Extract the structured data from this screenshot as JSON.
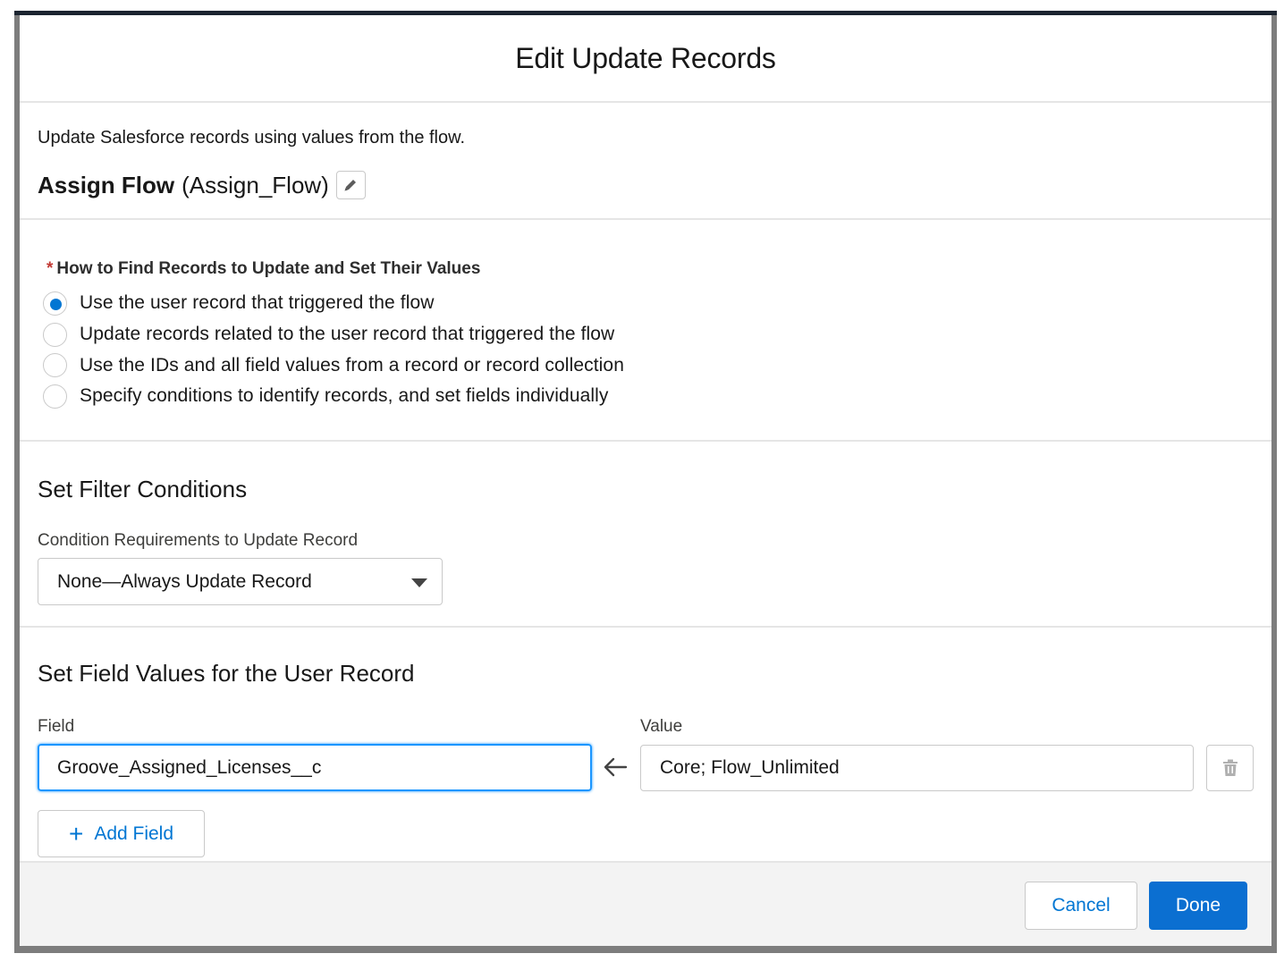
{
  "modal": {
    "title": "Edit Update Records"
  },
  "description": {
    "text": "Update Salesforce records using values from the flow.",
    "element_label": "Assign Flow",
    "element_api_name": "(Assign_Flow)"
  },
  "find_records": {
    "required_marker": "*",
    "label": "How to Find Records to Update and Set Their Values",
    "options": [
      {
        "label": "Use the user record that triggered the flow",
        "selected": true
      },
      {
        "label": "Update records related to the user record that triggered the flow",
        "selected": false
      },
      {
        "label": "Use the IDs and all field values from a record or record collection",
        "selected": false
      },
      {
        "label": "Specify conditions to identify records, and set fields individually",
        "selected": false
      }
    ]
  },
  "filter": {
    "heading": "Set Filter Conditions",
    "condition_label": "Condition Requirements to Update Record",
    "condition_value": "None—Always Update Record"
  },
  "field_values": {
    "heading": "Set Field Values for the User Record",
    "field_label": "Field",
    "value_label": "Value",
    "rows": [
      {
        "field": "Groove_Assigned_Licenses__c",
        "value": "Core; Flow_Unlimited"
      }
    ],
    "add_field_label": "Add Field"
  },
  "footer": {
    "cancel_label": "Cancel",
    "done_label": "Done"
  },
  "icons": {
    "edit": "pencil-icon",
    "caret": "caret-down-icon",
    "assign": "arrow-left-icon",
    "delete": "trash-icon",
    "add": "plus-icon"
  },
  "colors": {
    "brand": "#0176d3",
    "required": "#c23934",
    "focus": "#1b96ff"
  }
}
